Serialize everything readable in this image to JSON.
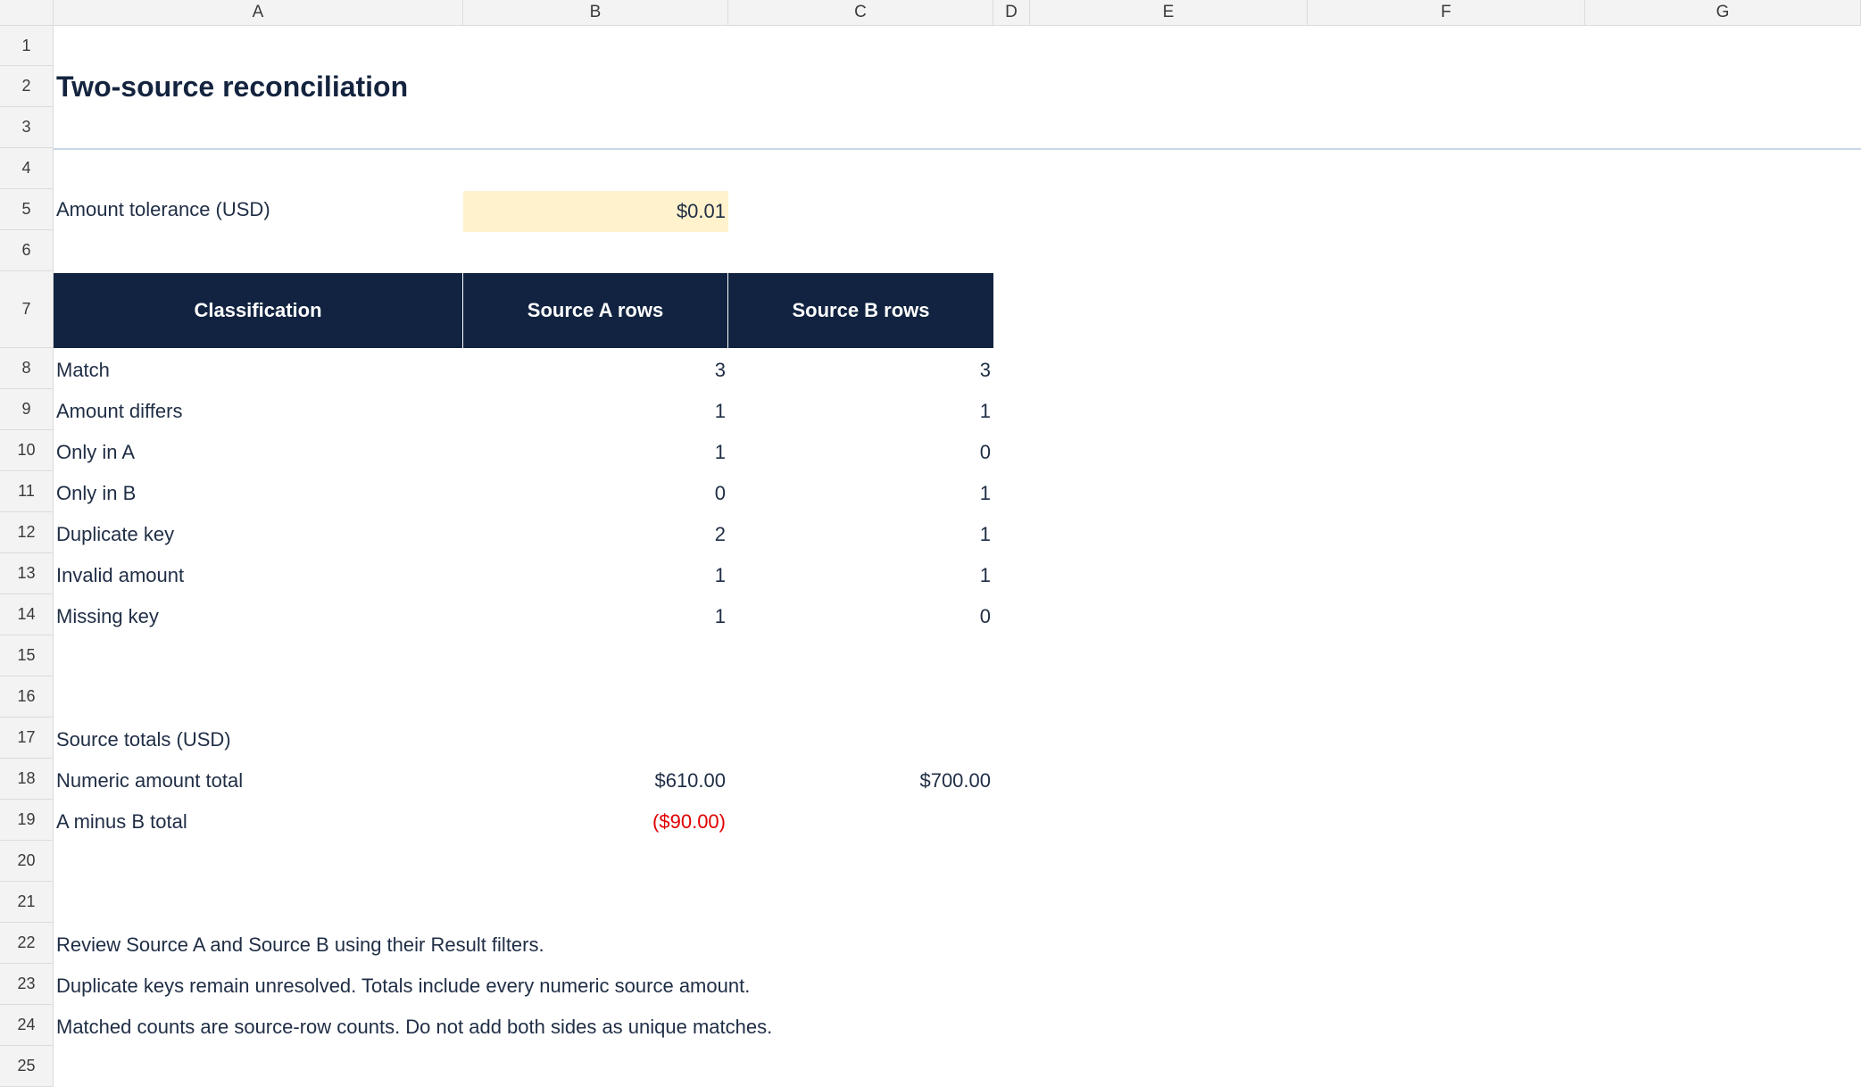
{
  "columns": [
    "A",
    "B",
    "C",
    "D",
    "E",
    "F",
    "G"
  ],
  "rows": [
    "1",
    "2",
    "3",
    "4",
    "5",
    "6",
    "7",
    "8",
    "9",
    "10",
    "11",
    "12",
    "13",
    "14",
    "15",
    "16",
    "17",
    "18",
    "19",
    "20",
    "21",
    "22",
    "23",
    "24",
    "25"
  ],
  "sheet": {
    "title": "Two-source reconciliation",
    "tolerance_label": "Amount tolerance (USD)",
    "tolerance_value": "$0.01",
    "table": {
      "headers": [
        "Classification",
        "Source A rows",
        "Source B rows"
      ],
      "rows": [
        {
          "label": "Match",
          "a": "3",
          "b": "3"
        },
        {
          "label": "Amount differs",
          "a": "1",
          "b": "1"
        },
        {
          "label": "Only in A",
          "a": "1",
          "b": "0"
        },
        {
          "label": "Only in B",
          "a": "0",
          "b": "1"
        },
        {
          "label": "Duplicate key",
          "a": "2",
          "b": "1"
        },
        {
          "label": "Invalid amount",
          "a": "1",
          "b": "1"
        },
        {
          "label": "Missing key",
          "a": "1",
          "b": "0"
        }
      ]
    },
    "totals_heading": "Source totals (USD)",
    "numeric_total_label": "Numeric amount total",
    "numeric_total_a": "$610.00",
    "numeric_total_b": "$700.00",
    "diff_label": "A minus B total",
    "diff_value": "($90.00)",
    "notes": [
      "Review Source A and Source B using their Result filters.",
      "Duplicate keys remain unresolved. Totals include every numeric source amount.",
      "Matched counts are source-row counts. Do not add both sides as unique matches."
    ]
  },
  "colors": {
    "header_fill": "#112340",
    "input_fill": "#fff2cc",
    "negative": "#e00000"
  }
}
